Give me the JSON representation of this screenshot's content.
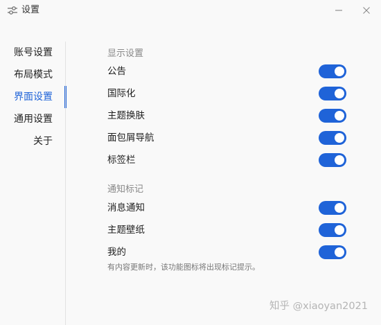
{
  "window": {
    "title": "设置",
    "settings_icon": "sliders-icon",
    "minimize_icon": "minimize-icon",
    "close_icon": "close-icon"
  },
  "sidebar": {
    "items": [
      {
        "label": "账号设置",
        "active": false
      },
      {
        "label": "布局模式",
        "active": false
      },
      {
        "label": "界面设置",
        "active": true
      },
      {
        "label": "通用设置",
        "active": false
      },
      {
        "label": "关于",
        "active": false
      }
    ]
  },
  "display_section": {
    "title": "显示设置",
    "rows": [
      {
        "label": "公告",
        "enabled": true
      },
      {
        "label": "国际化",
        "enabled": true
      },
      {
        "label": "主题换肤",
        "enabled": true
      },
      {
        "label": "面包屑导航",
        "enabled": true
      },
      {
        "label": "标签栏",
        "enabled": true
      }
    ]
  },
  "notify_section": {
    "title": "通知标记",
    "rows": [
      {
        "label": "消息通知",
        "enabled": true
      },
      {
        "label": "主题壁纸",
        "enabled": true
      },
      {
        "label": "我的",
        "enabled": true
      }
    ],
    "hint": "有内容更新时，该功能图标将出现标记提示。"
  },
  "watermark": "知乎 @xiaoyan2021",
  "colors": {
    "accent": "#1f63d8",
    "background": "#f9f9f9",
    "divider": "#e2e2e2"
  }
}
